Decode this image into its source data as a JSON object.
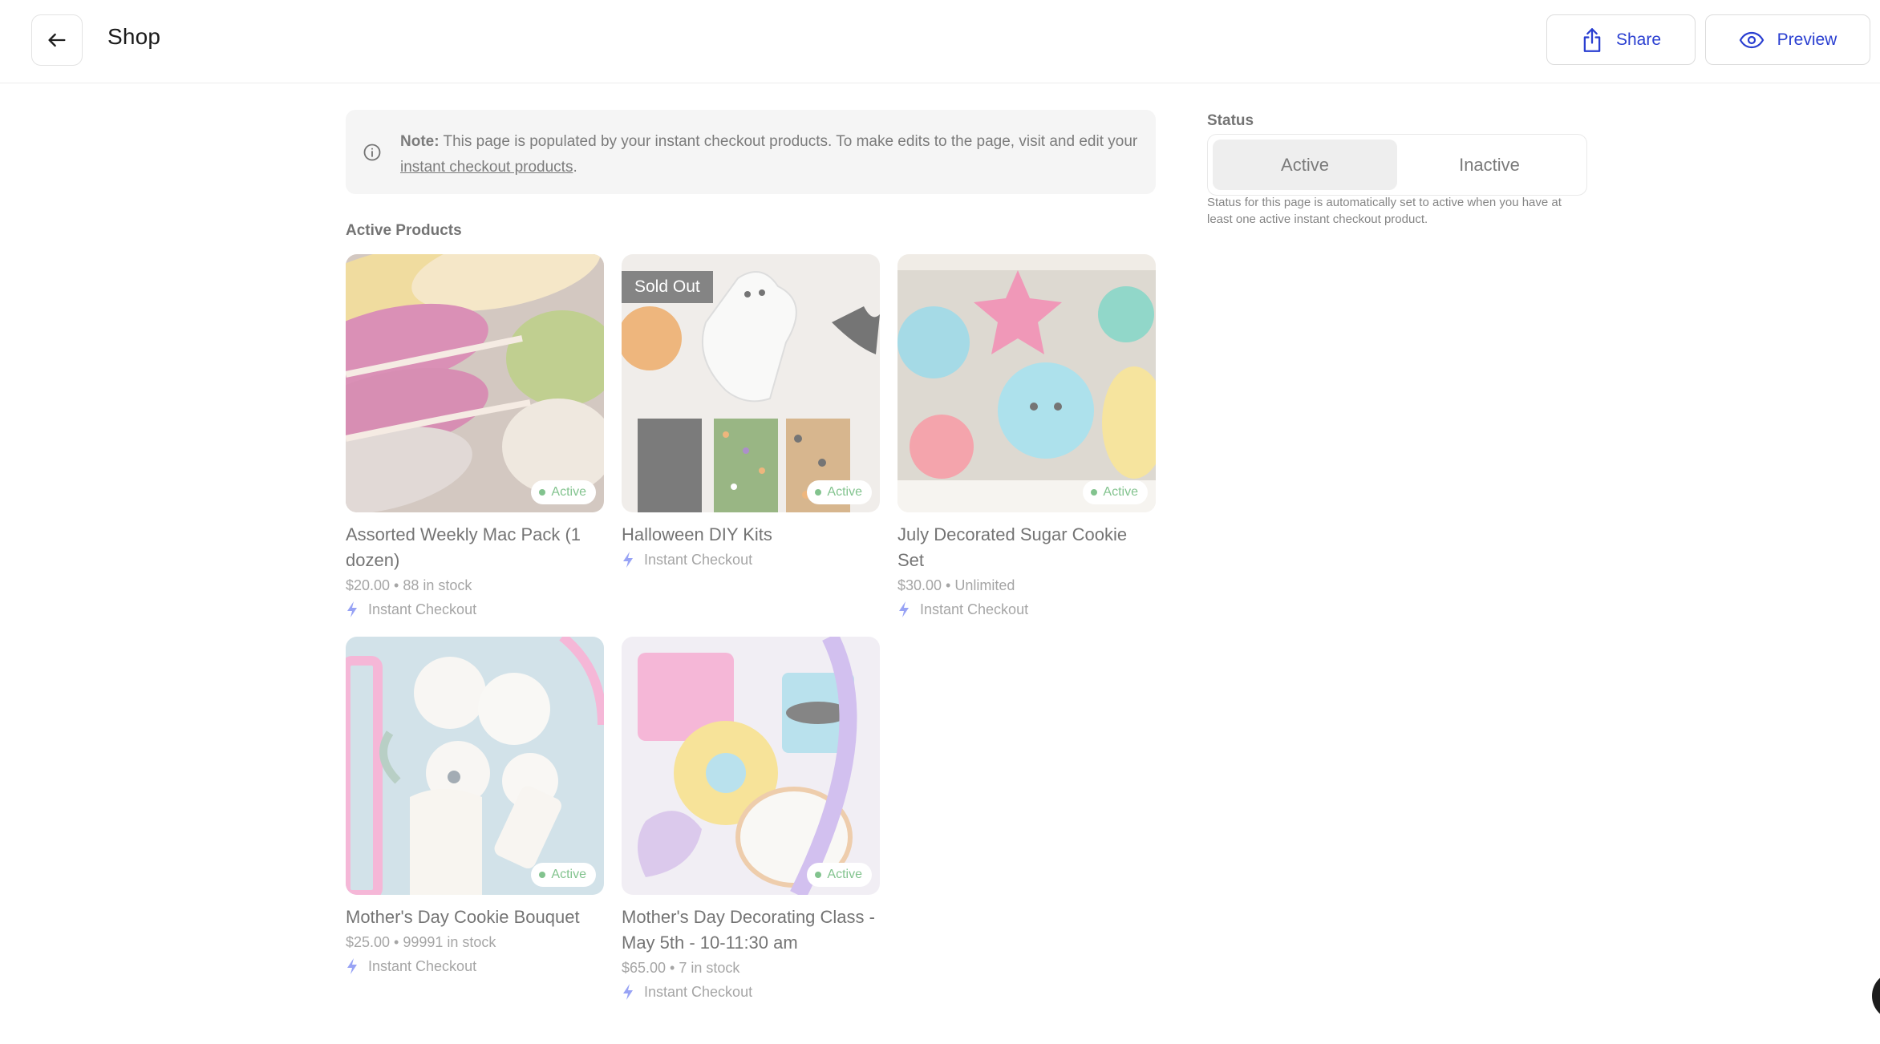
{
  "header": {
    "title": "Shop",
    "share_label": "Share",
    "preview_label": "Preview"
  },
  "note": {
    "bold": "Note:",
    "text": " This page is populated by your instant checkout products. To make edits to the page, visit and edit your ",
    "link": "instant checkout products",
    "end": "."
  },
  "section_title": "Active Products",
  "products": [
    {
      "name": "Assorted Weekly Mac Pack (1 dozen)",
      "meta": "$20.00 • 88 in stock",
      "checkout": "Instant Checkout",
      "badge": "Active"
    },
    {
      "name": "Halloween DIY Kits",
      "checkout": "Instant Checkout",
      "badge": "Active",
      "overlay": "Sold Out"
    },
    {
      "name": "July Decorated Sugar Cookie Set",
      "meta": "$30.00 • Unlimited",
      "checkout": "Instant Checkout",
      "badge": "Active"
    },
    {
      "name": "Mother's Day Cookie Bouquet",
      "meta": "$25.00 • 99991 in stock",
      "checkout": "Instant Checkout",
      "badge": "Active"
    },
    {
      "name": "Mother's Day Decorating Class - May 5th - 10-11:30 am",
      "meta": "$65.00 • 7 in stock",
      "checkout": "Instant Checkout",
      "badge": "Active"
    }
  ],
  "status": {
    "label": "Status",
    "options": [
      "Active",
      "Inactive"
    ],
    "selected": "Active",
    "help": "Status for this page is automatically set to active when you have at least one active instant checkout product."
  },
  "colors": {
    "accent": "#2a3fd1",
    "active_green": "#37a04a",
    "lightning": "#5a6cf0"
  },
  "icons": [
    "arrow-left-icon",
    "share-icon",
    "eye-icon",
    "info-icon",
    "lightning-icon"
  ]
}
